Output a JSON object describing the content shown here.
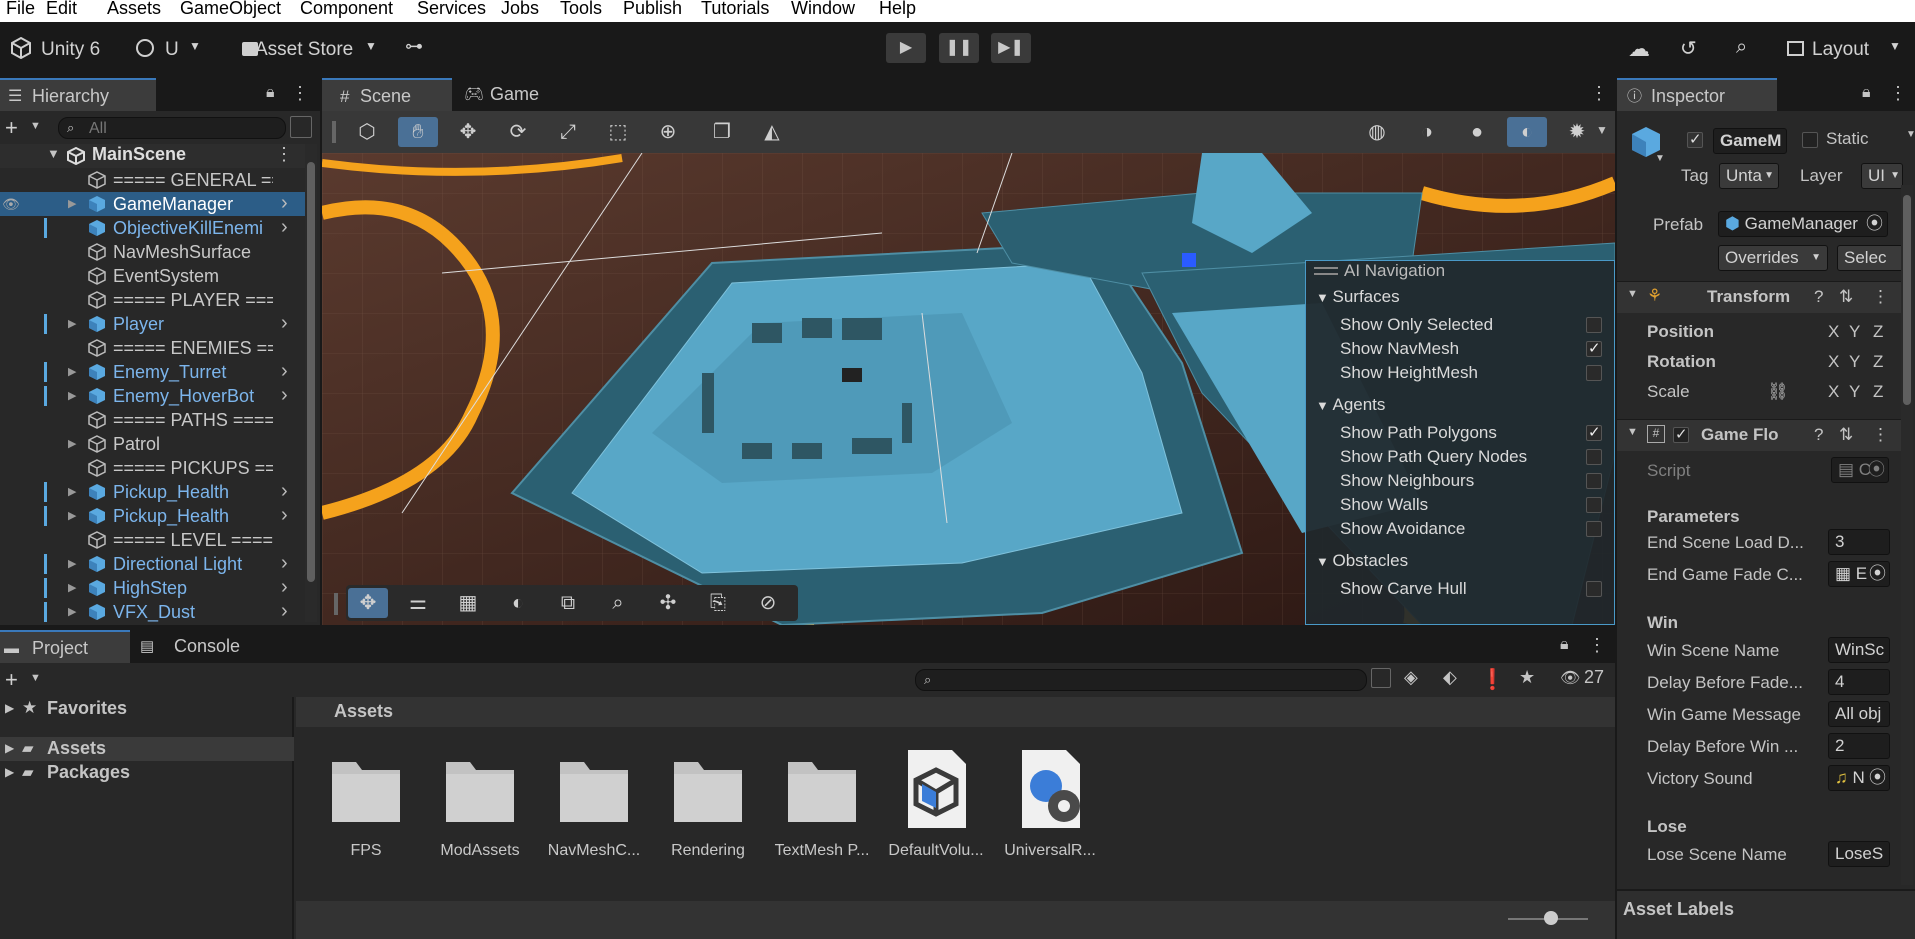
{
  "menu": [
    "File",
    "Edit",
    "Assets",
    "GameObject",
    "Component",
    "Services",
    "Jobs",
    "Tools",
    "Publish",
    "Tutorials",
    "Window",
    "Help"
  ],
  "toolbar": {
    "app": "Unity 6",
    "account": "U",
    "asset_store": "Asset Store",
    "layout": "Layout"
  },
  "hierarchy": {
    "tab": "Hierarchy",
    "search_placeholder": "All",
    "scene": "MainScene",
    "items": [
      {
        "label": "===== GENERAL ===",
        "blue": false,
        "arrow": false,
        "chevron": false,
        "prefab": false
      },
      {
        "label": "GameManager",
        "blue": false,
        "arrow": true,
        "chevron": true,
        "prefab": true,
        "selected": true
      },
      {
        "label": "ObjectiveKillEnemi",
        "blue": true,
        "arrow": false,
        "chevron": true,
        "prefab": true
      },
      {
        "label": "NavMeshSurface",
        "blue": false,
        "arrow": false,
        "chevron": false,
        "prefab": false
      },
      {
        "label": "EventSystem",
        "blue": false,
        "arrow": false,
        "chevron": false,
        "prefab": false
      },
      {
        "label": "===== PLAYER ====",
        "blue": false,
        "arrow": false,
        "chevron": false,
        "prefab": false
      },
      {
        "label": "Player",
        "blue": true,
        "arrow": true,
        "chevron": true,
        "prefab": true
      },
      {
        "label": "===== ENEMIES ===",
        "blue": false,
        "arrow": false,
        "chevron": false,
        "prefab": false
      },
      {
        "label": "Enemy_Turret",
        "blue": true,
        "arrow": true,
        "chevron": true,
        "prefab": true
      },
      {
        "label": "Enemy_HoverBot",
        "blue": true,
        "arrow": true,
        "chevron": true,
        "prefab": true
      },
      {
        "label": "===== PATHS =====",
        "blue": false,
        "arrow": false,
        "chevron": false,
        "prefab": false
      },
      {
        "label": "Patrol",
        "blue": false,
        "arrow": true,
        "chevron": false,
        "prefab": false
      },
      {
        "label": "===== PICKUPS ===",
        "blue": false,
        "arrow": false,
        "chevron": false,
        "prefab": false
      },
      {
        "label": "Pickup_Health",
        "blue": true,
        "arrow": true,
        "chevron": true,
        "prefab": true
      },
      {
        "label": "Pickup_Health",
        "blue": true,
        "arrow": true,
        "chevron": true,
        "prefab": true
      },
      {
        "label": "===== LEVEL =====",
        "blue": false,
        "arrow": false,
        "chevron": false,
        "prefab": false
      },
      {
        "label": "Directional Light",
        "blue": true,
        "arrow": true,
        "chevron": true,
        "prefab": true
      },
      {
        "label": "HighStep",
        "blue": true,
        "arrow": true,
        "chevron": true,
        "prefab": true
      },
      {
        "label": "VFX_Dust",
        "blue": true,
        "arrow": true,
        "chevron": true,
        "prefab": true
      }
    ]
  },
  "scene_tabs": {
    "scene": "Scene",
    "game": "Game"
  },
  "ai_nav": {
    "title": "AI Navigation",
    "sections": [
      {
        "name": "Surfaces",
        "rows": [
          {
            "label": "Show Only Selected",
            "checked": false
          },
          {
            "label": "Show NavMesh",
            "checked": true
          },
          {
            "label": "Show HeightMesh",
            "checked": false
          }
        ]
      },
      {
        "name": "Agents",
        "rows": [
          {
            "label": "Show Path Polygons",
            "checked": true
          },
          {
            "label": "Show Path Query Nodes",
            "checked": false
          },
          {
            "label": "Show Neighbours",
            "checked": false
          },
          {
            "label": "Show Walls",
            "checked": false
          },
          {
            "label": "Show Avoidance",
            "checked": false
          }
        ]
      },
      {
        "name": "Obstacles",
        "rows": [
          {
            "label": "Show Carve Hull",
            "checked": false
          }
        ]
      }
    ]
  },
  "inspector": {
    "tab": "Inspector",
    "name": "GameM",
    "static": "Static",
    "tag_label": "Tag",
    "tag": "Unta",
    "layer_label": "Layer",
    "layer": "UI",
    "prefab_label": "Prefab",
    "prefab": "GameManager",
    "overrides": "Overrides",
    "select": "Selec",
    "transform": {
      "title": "Transform",
      "position": "Position",
      "rotation": "Rotation",
      "scale": "Scale",
      "x": "X",
      "y": "Y",
      "z": "Z"
    },
    "flow": {
      "title": "Game Flo",
      "script_label": "Script",
      "script": "C",
      "parameters": "Parameters",
      "end_scene_label": "End Scene Load D...",
      "end_scene": "3",
      "end_fade_label": "End Game Fade C...",
      "end_fade": "E",
      "win": "Win",
      "win_scene_label": "Win Scene Name",
      "win_scene": "WinSc",
      "delay_fade_label": "Delay Before Fade...",
      "delay_fade": "4",
      "win_msg_label": "Win Game Message",
      "win_msg": "All obj",
      "delay_win_label": "Delay Before Win ...",
      "delay_win": "2",
      "victory_label": "Victory Sound",
      "victory": "N",
      "lose": "Lose",
      "lose_scene_label": "Lose Scene Name",
      "lose_scene": "LoseS"
    },
    "asset_labels": "Asset Labels"
  },
  "project": {
    "tab_project": "Project",
    "tab_console": "Console",
    "count": "27",
    "favorites": "Favorites",
    "assets_tree": "Assets",
    "packages": "Packages",
    "assets_header": "Assets",
    "items": [
      {
        "label": "FPS",
        "kind": "folder"
      },
      {
        "label": "ModAssets",
        "kind": "folder"
      },
      {
        "label": "NavMeshC...",
        "kind": "folder"
      },
      {
        "label": "Rendering",
        "kind": "folder"
      },
      {
        "label": "TextMesh P...",
        "kind": "folder"
      },
      {
        "label": "DefaultVolu...",
        "kind": "asset-cube"
      },
      {
        "label": "UniversalR...",
        "kind": "asset-gear"
      }
    ]
  }
}
